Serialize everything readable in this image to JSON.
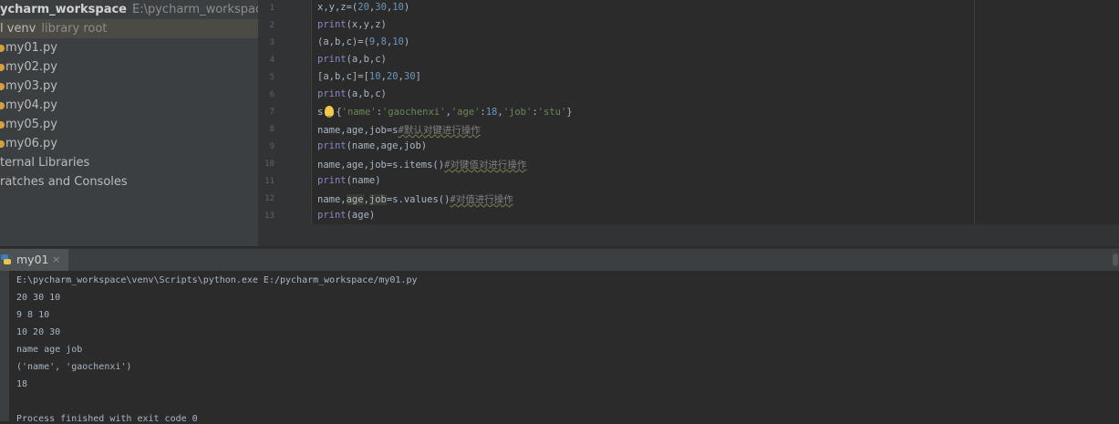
{
  "project_tree": {
    "root_name": "ycharm_workspace",
    "root_path": "E:\\pycharm_workspace",
    "venv_name": "l venv",
    "venv_note": "library root",
    "files": [
      "my01.py",
      "my02.py",
      "my03.py",
      "my04.py",
      "my05.py",
      "my06.py"
    ],
    "external_libraries": "ternal Libraries",
    "scratches": "ratches and Consoles"
  },
  "editor": {
    "line_numbers": [
      "1",
      "2",
      "3",
      "4",
      "5",
      "6",
      "7",
      "8",
      "9",
      "10",
      "11",
      "12",
      "13"
    ],
    "lines": [
      [
        {
          "t": "x,y,z",
          "c": ""
        },
        {
          "t": "=(",
          "c": ""
        },
        {
          "t": "20",
          "c": "num"
        },
        {
          "t": ",",
          "c": ""
        },
        {
          "t": "30",
          "c": "num"
        },
        {
          "t": ",",
          "c": ""
        },
        {
          "t": "10",
          "c": "num"
        },
        {
          "t": ")",
          "c": ""
        }
      ],
      [
        {
          "t": "print",
          "c": "kw"
        },
        {
          "t": "(x,y,z)",
          "c": ""
        }
      ],
      [
        {
          "t": "(a,b,c)=(",
          "c": ""
        },
        {
          "t": "9",
          "c": "num"
        },
        {
          "t": ",",
          "c": ""
        },
        {
          "t": "8",
          "c": "num"
        },
        {
          "t": ",",
          "c": ""
        },
        {
          "t": "10",
          "c": "num"
        },
        {
          "t": ")",
          "c": ""
        }
      ],
      [
        {
          "t": "print",
          "c": "kw"
        },
        {
          "t": "(a,b,c)",
          "c": ""
        }
      ],
      [
        {
          "t": "[a,b,c]=[",
          "c": ""
        },
        {
          "t": "10",
          "c": "num"
        },
        {
          "t": ",",
          "c": ""
        },
        {
          "t": "20",
          "c": "num"
        },
        {
          "t": ",",
          "c": ""
        },
        {
          "t": "30",
          "c": "num"
        },
        {
          "t": "]",
          "c": ""
        }
      ],
      [
        {
          "t": "print",
          "c": "kw"
        },
        {
          "t": "(a,b,c)",
          "c": ""
        }
      ],
      [
        {
          "t": "s",
          "c": ""
        },
        {
          "t": "BULB",
          "c": "bulb"
        },
        {
          "t": "{",
          "c": ""
        },
        {
          "t": "'name'",
          "c": "str"
        },
        {
          "t": ":",
          "c": ""
        },
        {
          "t": "'gaochenxi'",
          "c": "str"
        },
        {
          "t": ",",
          "c": ""
        },
        {
          "t": "'age'",
          "c": "str"
        },
        {
          "t": ":",
          "c": ""
        },
        {
          "t": "18",
          "c": "num"
        },
        {
          "t": ",",
          "c": ""
        },
        {
          "t": "'job'",
          "c": "str"
        },
        {
          "t": ":",
          "c": ""
        },
        {
          "t": "'stu'",
          "c": "str"
        },
        {
          "t": "}",
          "c": ""
        }
      ],
      [
        {
          "t": "name,age,job=s",
          "c": ""
        },
        {
          "t": "#默认对键进行操作",
          "c": "cmt"
        }
      ],
      [
        {
          "t": "print",
          "c": "kw"
        },
        {
          "t": "(name,age,job)",
          "c": ""
        }
      ],
      [
        {
          "t": "name,age,job=s.items()",
          "c": ""
        },
        {
          "t": "#对键值对进行操作",
          "c": "cmt"
        }
      ],
      [
        {
          "t": "print",
          "c": "kw"
        },
        {
          "t": "(name)",
          "c": ""
        }
      ],
      [
        {
          "t": "name,",
          "c": ""
        },
        {
          "t": "age",
          "c": "hl"
        },
        {
          "t": ",",
          "c": ""
        },
        {
          "t": "job",
          "c": "hl"
        },
        {
          "t": "=s.values()",
          "c": ""
        },
        {
          "t": "#对值进行操作",
          "c": "cmt"
        }
      ],
      [
        {
          "t": "print",
          "c": "kw"
        },
        {
          "t": "(age)",
          "c": ""
        }
      ]
    ]
  },
  "run_panel": {
    "tab_label": "my01",
    "close_glyph": "×",
    "output_lines": [
      "E:\\pycharm_workspace\\venv\\Scripts\\python.exe E:/pycharm_workspace/my01.py",
      "20 30 10",
      "9 8 10",
      "10 20 30",
      "name age job",
      "('name', 'gaochenxi')",
      "18",
      "",
      "Process finished with exit code 0"
    ]
  }
}
